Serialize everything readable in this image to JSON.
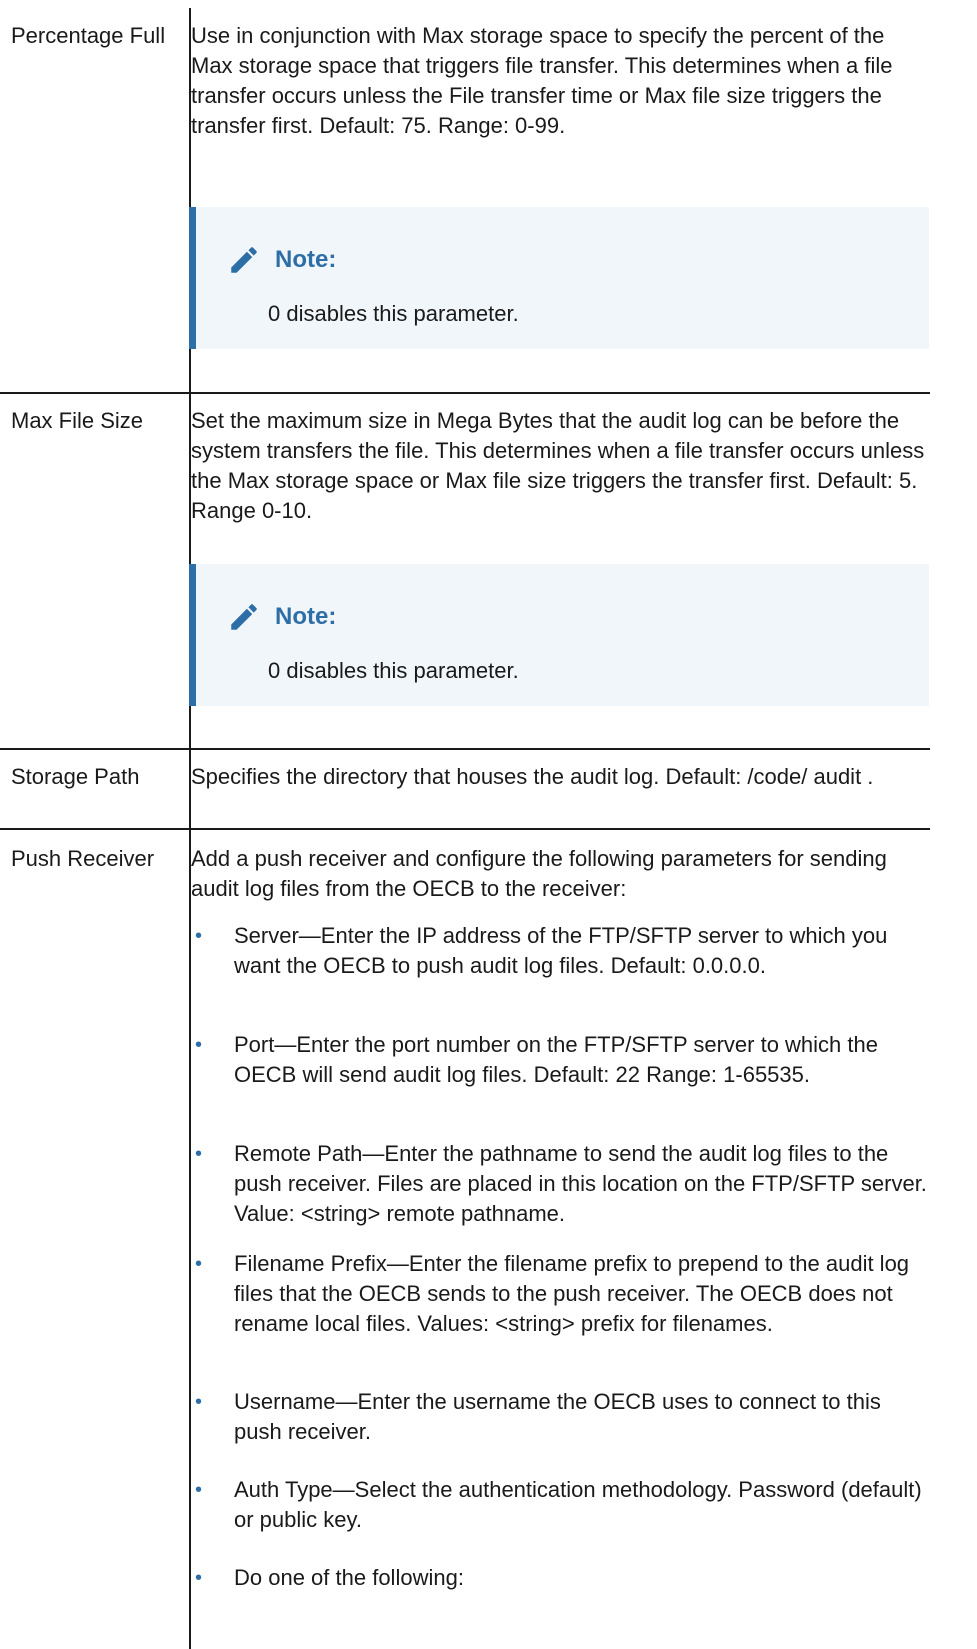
{
  "rows": [
    {
      "label": "Percentage Full",
      "desc": "Use in conjunction with Max storage space to specify the percent of the Max storage space that triggers file transfer. This determines when a file transfer occurs unless the File transfer time or Max file size triggers the transfer first. Default: 75. Range: 0-99.",
      "note_title": "Note:",
      "note_text": "0 disables this parameter."
    },
    {
      "label": "Max File Size",
      "desc": "Set the maximum size in Mega Bytes that the audit log can be before the system transfers the file. This determines when a file transfer occurs unless the Max storage space or Max file size triggers the transfer first. Default: 5. Range 0-10.",
      "note_title": "Note:",
      "note_text": "0 disables this parameter."
    },
    {
      "label": "Storage Path",
      "desc": "Specifies the directory that houses the audit log. Default: /code/ audit ."
    },
    {
      "label": "Push Receiver",
      "desc": "Add a push receiver and configure the following parameters for sending audit log files from the OECB to the receiver:"
    }
  ],
  "bullets": [
    "Server—Enter the IP address of the FTP/SFTP server to which you want the OECB to push audit log files. Default: 0.0.0.0.",
    "Port—Enter the port number on the FTP/SFTP server to which the OECB will send audit log files. Default: 22 Range: 1-65535.",
    "Remote Path—Enter the pathname to send the audit log files to the push receiver. Files are placed in this location on the FTP/SFTP server. Value: <string> remote pathname.",
    "Filename Prefix—Enter the filename prefix to prepend to the audit log files that the OECB sends to the push receiver. The OECB does not rename local files. Values: <string> prefix for filenames.",
    "Username—Enter the username the OECB uses to connect to this push receiver.",
    "Auth Type—Select the authentication methodology. Password (default) or public key.",
    "Do one of the following:"
  ],
  "colors": {
    "accent": "#2e6ea6",
    "note_bg": "#f1f6fb",
    "text": "#1a1a1a"
  },
  "icons": {
    "note": "pencil-icon",
    "bullet": "bullet-dot"
  }
}
